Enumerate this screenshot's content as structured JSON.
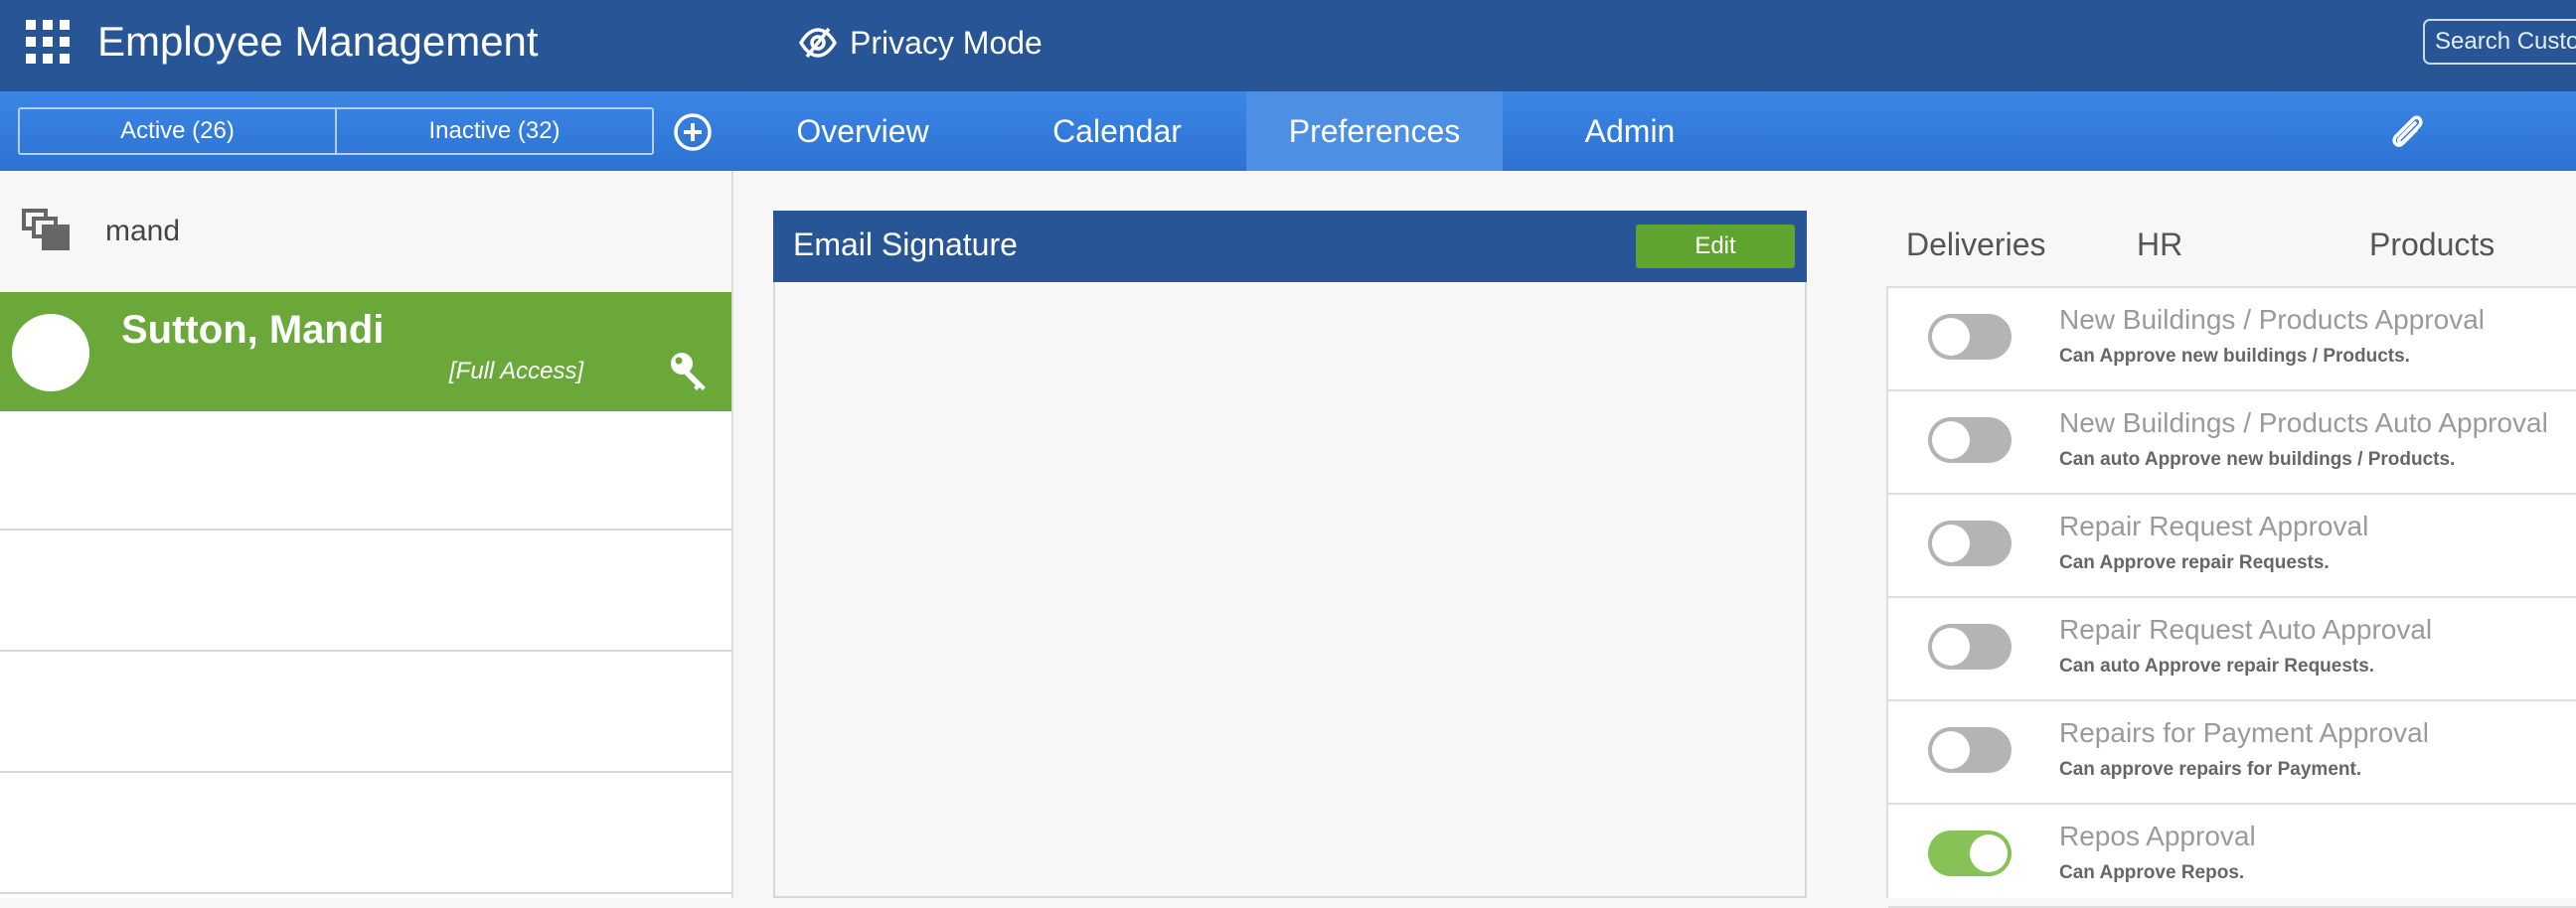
{
  "header": {
    "title": "Employee Management",
    "privacy_label": "Privacy Mode",
    "search_placeholder": "Search Customers"
  },
  "nav": {
    "segments": [
      {
        "label": "Active (26)"
      },
      {
        "label": "Inactive (32)"
      }
    ],
    "tabs": [
      {
        "label": "Overview",
        "active": false
      },
      {
        "label": "Calendar",
        "active": false
      },
      {
        "label": "Preferences",
        "active": true
      },
      {
        "label": "Admin",
        "active": false
      }
    ]
  },
  "left": {
    "filter_value": "mand",
    "selected_employee": {
      "name": "Sutton, Mandi",
      "access": "[Full Access]"
    }
  },
  "signature": {
    "title": "Email Signature",
    "edit_label": "Edit"
  },
  "permissions": {
    "tabs": [
      {
        "label": "Deliveries"
      },
      {
        "label": "HR"
      },
      {
        "label": "Products"
      }
    ],
    "items": [
      {
        "title": "New Buildings / Products Approval",
        "desc": "Can Approve new buildings / Products.",
        "enabled": false
      },
      {
        "title": "New Buildings / Products Auto Approval",
        "desc": "Can auto Approve new buildings / Products.",
        "enabled": false
      },
      {
        "title": "Repair Request Approval",
        "desc": "Can Approve repair Requests.",
        "enabled": false
      },
      {
        "title": "Repair Request Auto Approval",
        "desc": "Can auto Approve repair Requests.",
        "enabled": false
      },
      {
        "title": "Repairs for Payment Approval",
        "desc": "Can approve repairs for Payment.",
        "enabled": false
      },
      {
        "title": "Repos Approval",
        "desc": "Can Approve Repos.",
        "enabled": true
      }
    ]
  },
  "colors": {
    "header_bg": "#275596",
    "nav_bg": "#3b86e6",
    "active_row": "#69a839",
    "edit_button": "#5fa42f",
    "toggle_on": "#86c255",
    "toggle_off": "#b4b4b4"
  },
  "icons": {
    "apps": "apps-grid-icon",
    "privacy": "eye-slash-icon",
    "add": "plus-circle-icon",
    "attach": "paperclip-icon",
    "filter": "stacked-squares-icon",
    "access": "key-icon"
  }
}
